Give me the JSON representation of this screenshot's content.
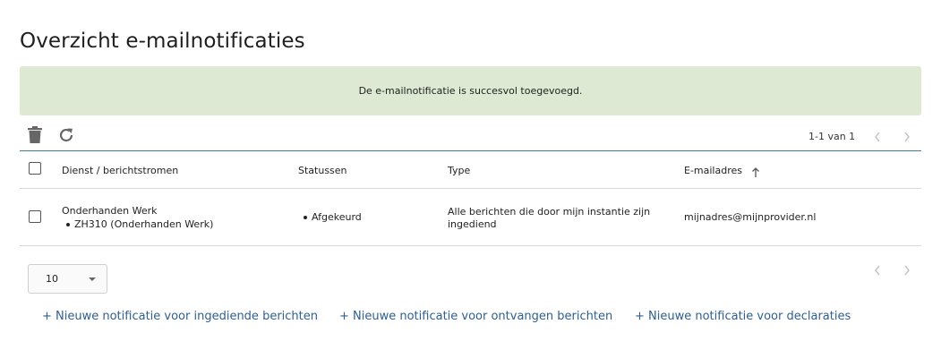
{
  "page": {
    "title": "Overzicht e-mailnotificaties"
  },
  "alert": {
    "message": "De e-mailnotificatie is succesvol toegevoegd."
  },
  "toolbar": {
    "delete_icon": "trash-icon",
    "refresh_icon": "refresh-icon",
    "pagination_text": "1-1 van 1"
  },
  "table": {
    "headers": {
      "dienst": "Dienst / berichtstromen",
      "statussen": "Statussen",
      "type": "Type",
      "email": "E-mailadres"
    },
    "sort_icon": "arrow-up-icon",
    "rows": [
      {
        "dienst": "Onderhanden Werk",
        "dienst_sub": "ZH310 (Onderhanden Werk)",
        "status": "Afgekeurd",
        "type_line1": "Alle berichten die door mijn instantie zijn",
        "type_line2": "ingediend",
        "email": "mijnadres@mijnprovider.nl"
      }
    ]
  },
  "footer": {
    "page_size": "10",
    "links": [
      "+ Nieuwe notificatie voor ingediende berichten",
      "+ Nieuwe notificatie voor ontvangen berichten",
      "+ Nieuwe notificatie voor declaraties"
    ]
  },
  "colors": {
    "alert_bg": "#dde9d3",
    "link": "#2f5f8f",
    "accent_line": "#3d7d98"
  }
}
